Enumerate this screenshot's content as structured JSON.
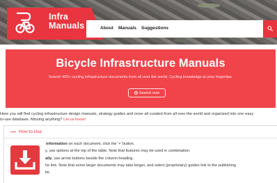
{
  "brand": {
    "name_line1": "Infra",
    "name_line2": "Manuals",
    "logo_icon": "bicycle-logo-icon"
  },
  "nav": {
    "items": [
      "About",
      "Manuals",
      "Suggestions"
    ],
    "search_icon": "search-icon"
  },
  "hero": {
    "title": "Bicycle Infrastructure Manuals",
    "subtitle": "Search 400+ cycling infrastructure documents from all over the world. Cycling knowledge at your fingertips.",
    "button_label": "Search now",
    "button_icon": "circle-play-icon"
  },
  "intro": {
    "line1": "Here you will find cycling infrastructure design manuals, strategy guides and more all curated from all over the world and organized into one easy",
    "line2_text": "to-use database. Missing anything?",
    "line2_link": "Let us know!"
  },
  "how_to_use": {
    "toggle": "—",
    "title": "How to Use",
    "lines": [
      {
        "bold": "information",
        "text": " on each document, click the '+' button."
      },
      {
        "bold": "",
        "text": "y, use options at the top of the table. Note that features may be used in combination."
      },
      {
        "bold": "ally",
        "text": ", use arrow buttons beside the column heading."
      },
      {
        "bold": "",
        "text": "he link. Note that some larger documents may take longer, and select (proprietary) guides link to the publishing"
      },
      {
        "bold": "",
        "text": "ite."
      }
    ]
  },
  "download_badge": {
    "icon": "pdf-download-icon"
  },
  "colors": {
    "accent": "#e8353f",
    "hero_bg": "#f0444a",
    "text": "#333333"
  }
}
